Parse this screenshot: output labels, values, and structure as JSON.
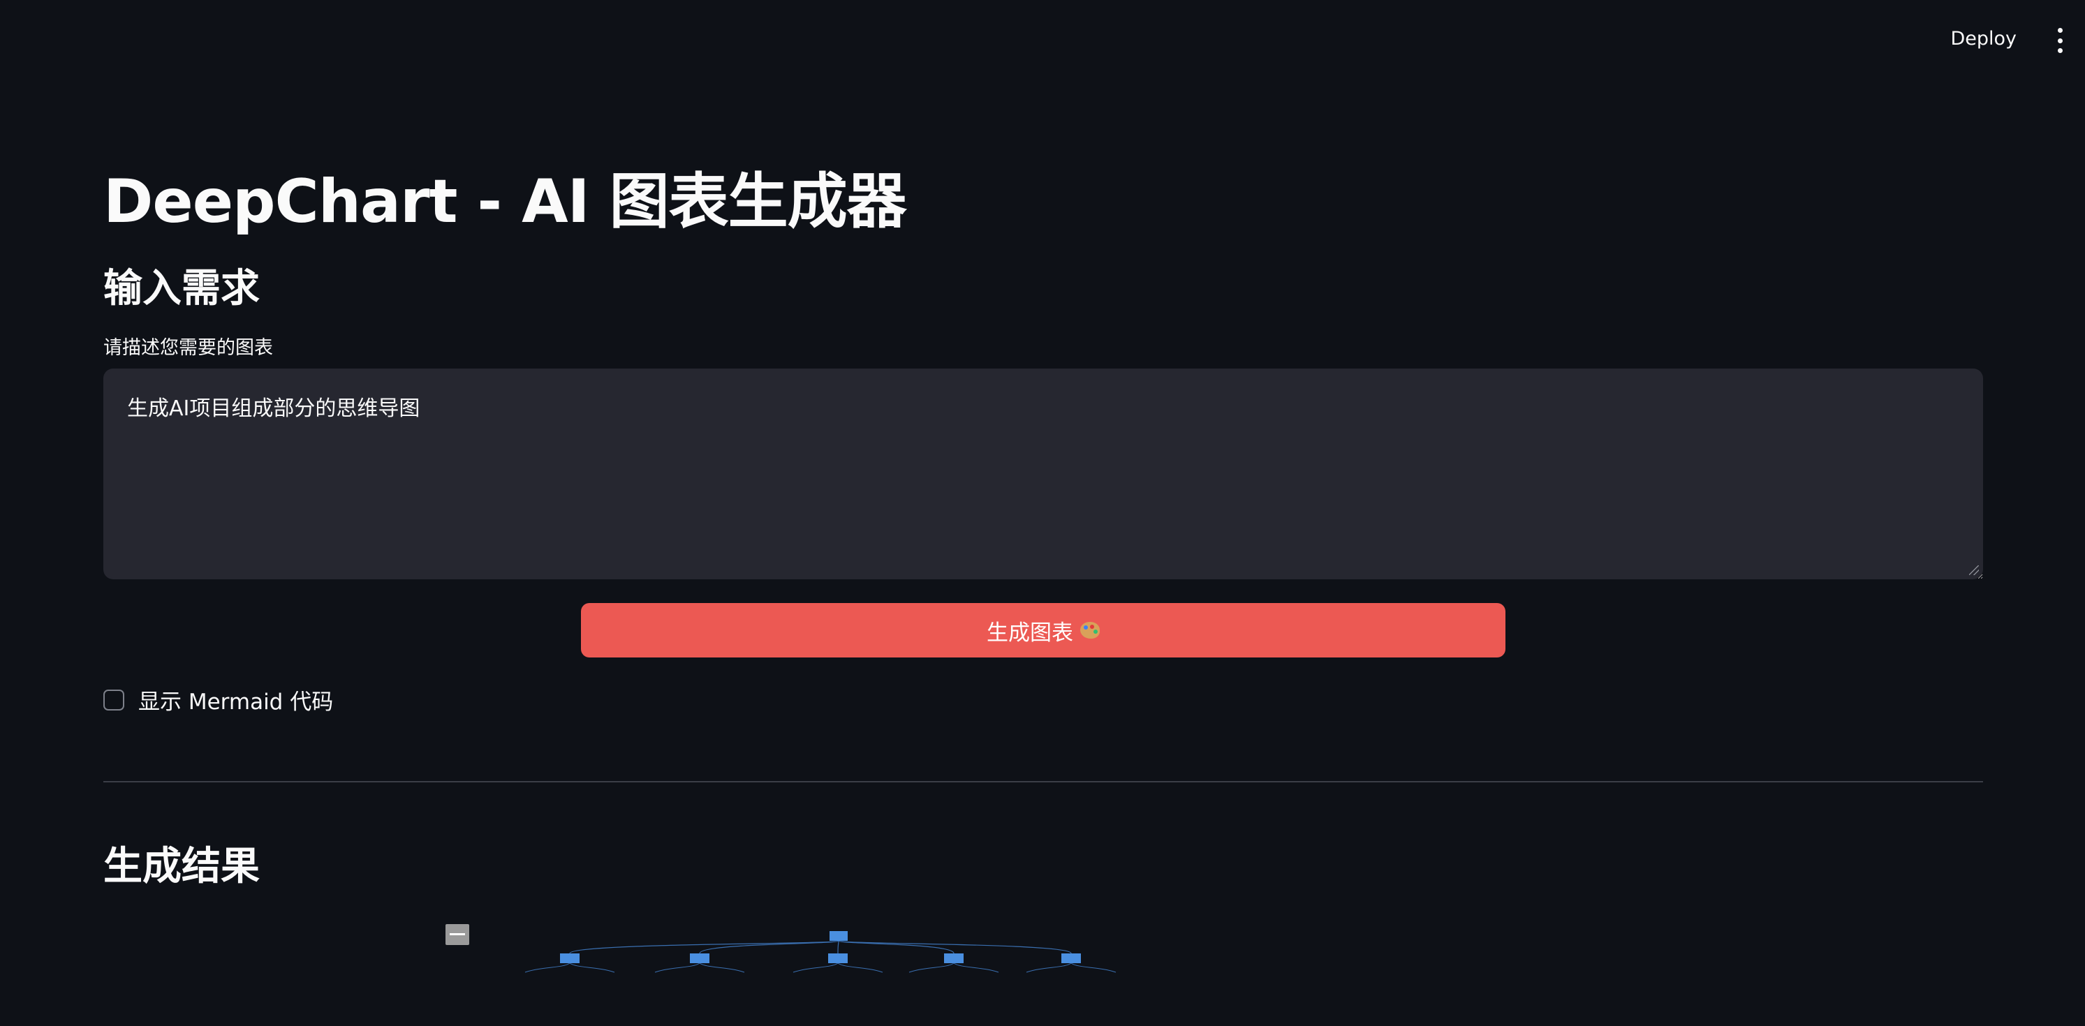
{
  "toolbar": {
    "deploy_label": "Deploy",
    "menu_icon": "vertical-dots-icon"
  },
  "main": {
    "title": "DeepChart - AI 图表生成器",
    "input_header": "输入需求",
    "textarea_label": "请描述您需要的图表",
    "textarea_value": "生成AI项目组成部分的思维导图",
    "generate_button": "生成图表",
    "generate_icon": "palette-icon",
    "show_code_label": "显示 Mermaid 代码",
    "result_header": "生成结果"
  },
  "diagram": {
    "root": "",
    "children": [
      "",
      "",
      "",
      "",
      ""
    ],
    "toggle_label": ""
  },
  "colors": {
    "background": "#0e1117",
    "input_bg": "#262730",
    "accent": "#ec5953",
    "node_blue": "#4a8fe0"
  }
}
